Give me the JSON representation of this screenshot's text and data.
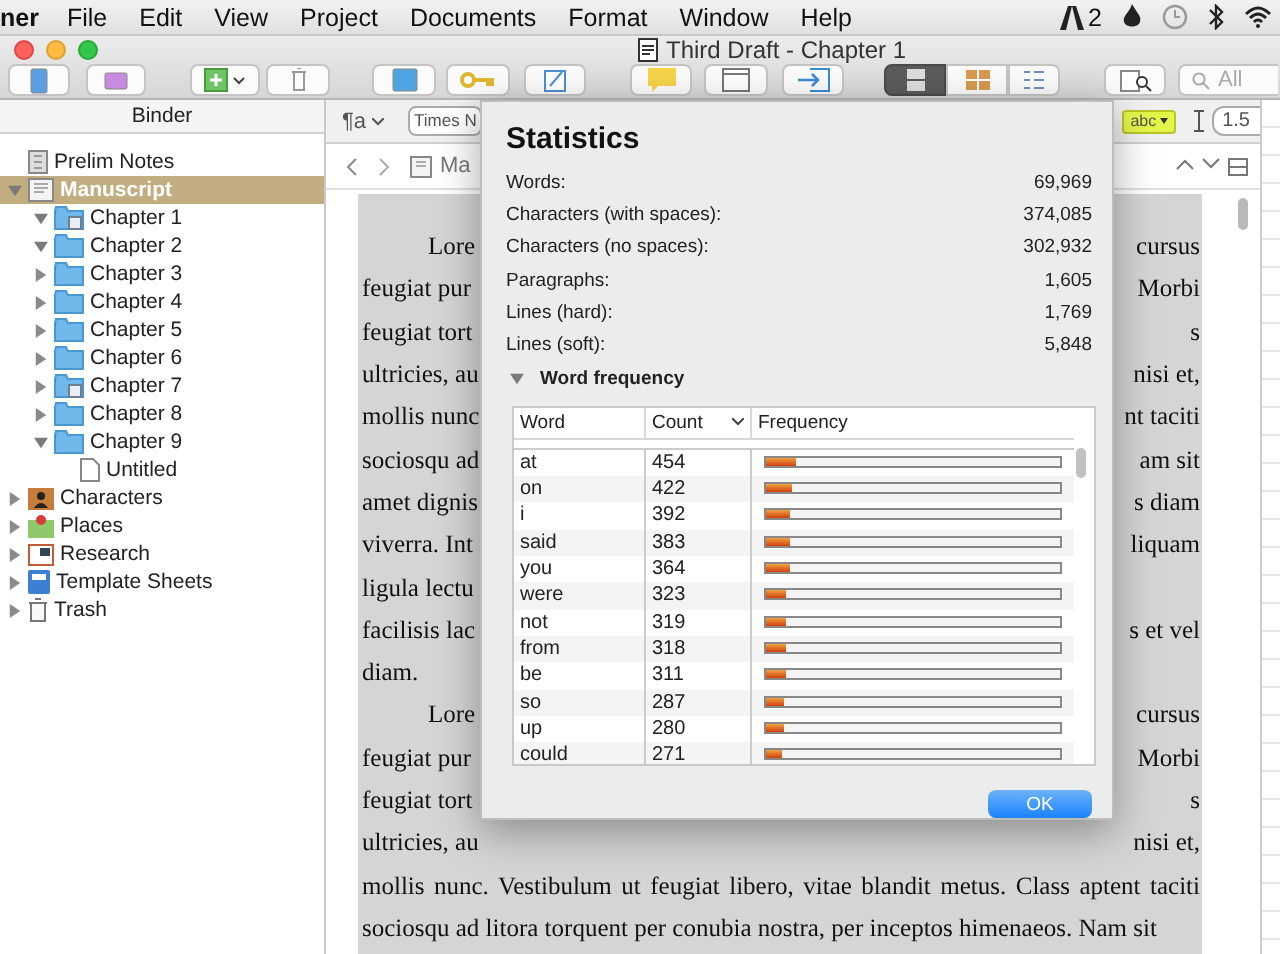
{
  "menu_bar": {
    "app": "ner",
    "items": [
      "File",
      "Edit",
      "View",
      "Project",
      "Documents",
      "Format",
      "Window",
      "Help"
    ],
    "status_count": "2"
  },
  "window": {
    "title": "Third Draft - Chapter 1"
  },
  "toolbar": {
    "view_modes": [
      {
        "selected": true
      },
      {
        "selected": false
      },
      {
        "selected": false
      }
    ],
    "search": {
      "placeholder": "All"
    }
  },
  "binder": {
    "title": "Binder",
    "items": [
      {
        "label": "Prelim Notes",
        "kind": "document",
        "selected": false
      },
      {
        "label": "Manuscript",
        "kind": "manuscript",
        "selected": true,
        "expanded": true,
        "children": [
          {
            "label": "Chapter 1",
            "kind": "folder-doc",
            "selected": false,
            "expanded": true
          },
          {
            "label": "Chapter 2",
            "kind": "folder",
            "selected": false,
            "expanded": true
          },
          {
            "label": "Chapter 3",
            "kind": "folder",
            "selected": false,
            "expanded": false
          },
          {
            "label": "Chapter 4",
            "kind": "folder",
            "selected": false,
            "expanded": false
          },
          {
            "label": "Chapter 5",
            "kind": "folder",
            "selected": false,
            "expanded": false
          },
          {
            "label": "Chapter 6",
            "kind": "folder",
            "selected": false,
            "expanded": false
          },
          {
            "label": "Chapter 7",
            "kind": "folder-doc",
            "selected": false,
            "expanded": false
          },
          {
            "label": "Chapter 8",
            "kind": "folder",
            "selected": false,
            "expanded": false
          },
          {
            "label": "Chapter 9",
            "kind": "folder",
            "selected": false,
            "expanded": true,
            "children": [
              {
                "label": "Untitled",
                "kind": "page",
                "selected": false
              }
            ]
          }
        ]
      },
      {
        "label": "Characters",
        "kind": "characters",
        "selected": false,
        "expanded": false
      },
      {
        "label": "Places",
        "kind": "places",
        "selected": false,
        "expanded": false
      },
      {
        "label": "Research",
        "kind": "research",
        "selected": false,
        "expanded": false
      },
      {
        "label": "Template Sheets",
        "kind": "templates",
        "selected": false,
        "expanded": false
      },
      {
        "label": "Trash",
        "kind": "trash",
        "selected": false,
        "expanded": false
      }
    ]
  },
  "format_bar": {
    "style_label": "¶a",
    "font": "Times N",
    "highlight": "abc",
    "line_spacing": "1.5"
  },
  "nav_bar": {
    "document": "Ma"
  },
  "document": {
    "paragraphs": [
      {
        "lines": [
          {
            "left": "Lore",
            "right": "cursus"
          },
          {
            "left": "feugiat pur",
            "right": "Morbi"
          },
          {
            "left": "feugiat tort",
            "right": "s"
          },
          {
            "left": "ultricies, au",
            "right": "nisi et,"
          },
          {
            "left": "mollis nunc",
            "right": "nt taciti"
          },
          {
            "left": "sociosqu ad",
            "right": "am sit"
          },
          {
            "left": "amet dignis",
            "right": "s diam"
          },
          {
            "left": "viverra. Int",
            "right": "liquam"
          },
          {
            "left": "ligula lectu"
          },
          {
            "left": "facilisis lac",
            "right": "s et vel"
          },
          {
            "left": "diam."
          }
        ]
      },
      {
        "lines": [
          {
            "left": "Lore",
            "right": "cursus"
          },
          {
            "left": "feugiat pur",
            "right": "Morbi"
          },
          {
            "left": "feugiat tort",
            "right": "s"
          },
          {
            "left": "ultricies, au",
            "right": "nisi et,"
          },
          {
            "left": "mollis nunc. Vestibulum ut feugiat libero, vitae blandit metus. Class aptent taciti"
          },
          {
            "left": "sociosqu ad litora torquent per conubia nostra, per inceptos himenaeos. Nam sit"
          }
        ]
      }
    ]
  },
  "statistics": {
    "title": "Statistics",
    "rows": [
      {
        "label": "Words:",
        "value": "69,969"
      },
      {
        "label": "Characters (with spaces):",
        "value": "374,085"
      },
      {
        "label": "Characters (no spaces):",
        "value": "302,932"
      },
      {
        "label": "Paragraphs:",
        "value": "1,605"
      },
      {
        "label": "Lines (hard):",
        "value": "1,769"
      },
      {
        "label": "Lines (soft):",
        "value": "5,848"
      }
    ],
    "word_frequency": {
      "label": "Word frequency",
      "expanded": true,
      "columns": [
        "Word",
        "Count",
        "Frequency"
      ],
      "rows": [
        {
          "word": "at",
          "count": "454",
          "level": 0.1
        },
        {
          "word": "on",
          "count": "422",
          "level": 0.09
        },
        {
          "word": "i",
          "count": "392",
          "level": 0.085
        },
        {
          "word": "said",
          "count": "383",
          "level": 0.08
        },
        {
          "word": "you",
          "count": "364",
          "level": 0.08
        },
        {
          "word": "were",
          "count": "323",
          "level": 0.07
        },
        {
          "word": "not",
          "count": "319",
          "level": 0.065
        },
        {
          "word": "from",
          "count": "318",
          "level": 0.065
        },
        {
          "word": "be",
          "count": "311",
          "level": 0.065
        },
        {
          "word": "so",
          "count": "287",
          "level": 0.06
        },
        {
          "word": "up",
          "count": "280",
          "level": 0.06
        },
        {
          "word": "could",
          "count": "271",
          "level": 0.055
        }
      ]
    },
    "ok_button": "OK"
  }
}
